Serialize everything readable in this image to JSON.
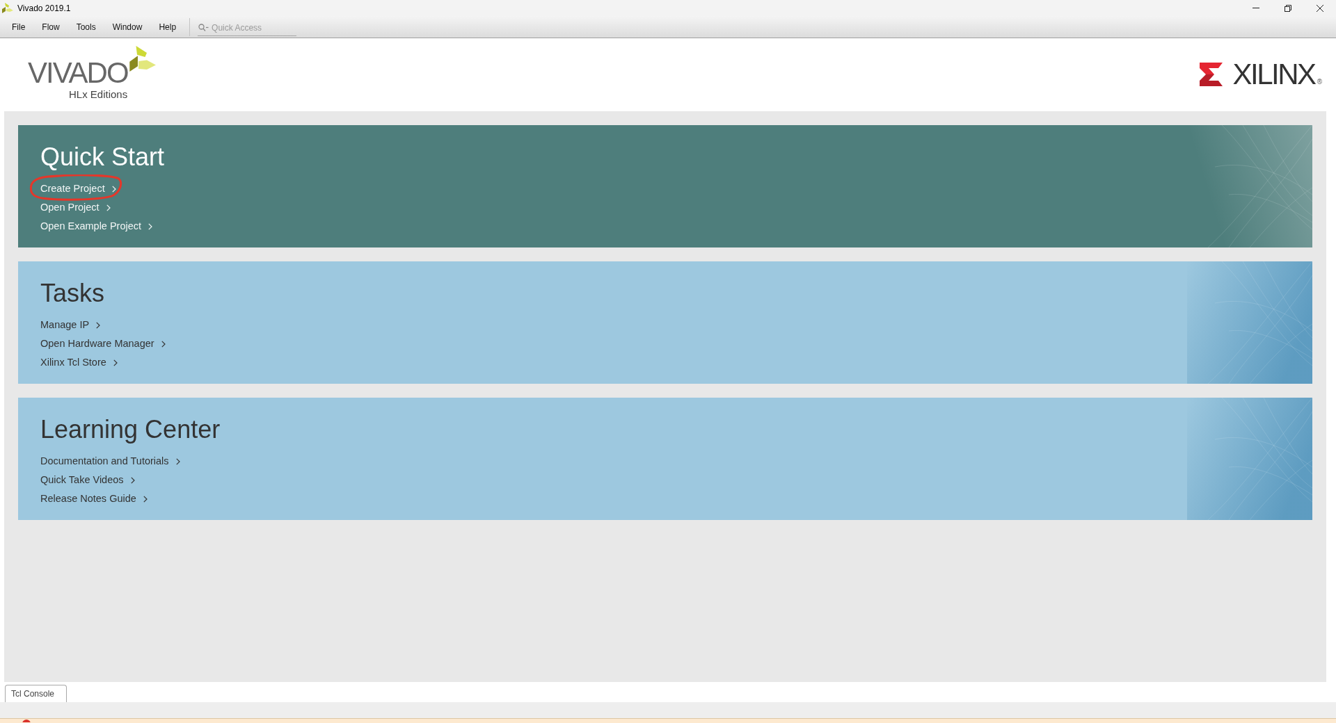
{
  "window": {
    "title": "Vivado 2019.1"
  },
  "menu": [
    {
      "label": "File"
    },
    {
      "label": "Flow"
    },
    {
      "label": "Tools"
    },
    {
      "label": "Window"
    },
    {
      "label": "Help"
    }
  ],
  "quick_access": {
    "placeholder": "Quick Access"
  },
  "header": {
    "product_logo": {
      "wordmark": "VIVADO",
      "edition": "HLx Editions"
    },
    "company_logo": {
      "wordmark": "XILINX",
      "mark": "®"
    }
  },
  "sections": [
    {
      "title": "Quick Start",
      "color": "#4e7e7c",
      "links": [
        {
          "label": "Create Project",
          "circled": true
        },
        {
          "label": "Open Project",
          "circled": false
        },
        {
          "label": "Open Example Project",
          "circled": false
        }
      ]
    },
    {
      "title": "Tasks",
      "color": "#9dc8df",
      "links": [
        {
          "label": "Manage IP",
          "circled": false
        },
        {
          "label": "Open Hardware Manager",
          "circled": false
        },
        {
          "label": "Xilinx Tcl Store",
          "circled": false
        }
      ]
    },
    {
      "title": "Learning Center",
      "color": "#9dc8df",
      "links": [
        {
          "label": "Documentation and Tutorials",
          "circled": false
        },
        {
          "label": "Quick Take Videos",
          "circled": false
        },
        {
          "label": "Release Notes Guide",
          "circled": false
        }
      ]
    }
  ],
  "bottom_tabs": [
    {
      "label": "Tcl Console",
      "selected": true
    }
  ]
}
